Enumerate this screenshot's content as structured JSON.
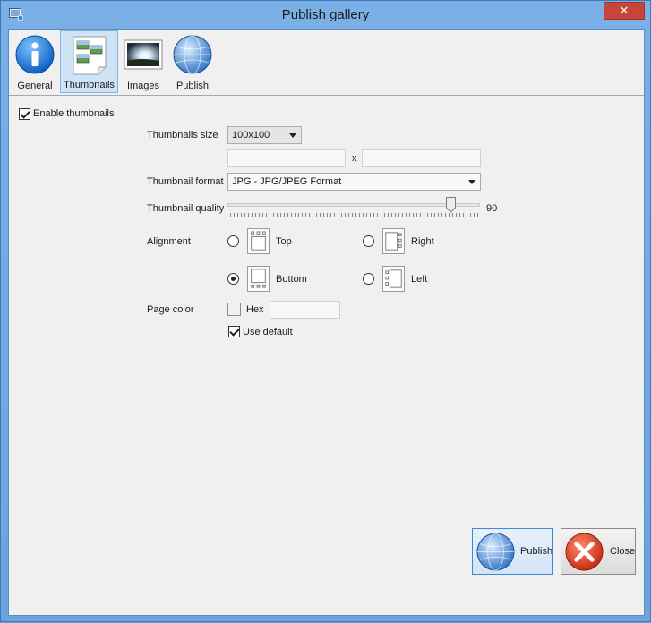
{
  "window": {
    "title": "Publish gallery",
    "close_symbol": "✕"
  },
  "toolbar": {
    "tabs": [
      {
        "label": "General",
        "icon": "info-icon"
      },
      {
        "label": "Thumbnails",
        "icon": "thumbnails-icon",
        "selected": true
      },
      {
        "label": "Images",
        "icon": "images-icon"
      },
      {
        "label": "Publish",
        "icon": "globe-icon"
      }
    ]
  },
  "form": {
    "enable_thumbnails": {
      "label": "Enable thumbnails",
      "checked": true
    },
    "thumbnails_size": {
      "label": "Thumbnails size",
      "value": "100x100"
    },
    "custom_size": {
      "separator": "x",
      "width": "",
      "height": ""
    },
    "thumbnail_format": {
      "label": "Thumbnail format",
      "value": "JPG - JPG/JPEG Format"
    },
    "thumbnail_quality": {
      "label": "Thumbnail quality",
      "value": "90",
      "level": 90,
      "min": 0,
      "max": 100
    },
    "alignment": {
      "label": "Alignment",
      "options": [
        {
          "label": "Top",
          "checked": false
        },
        {
          "label": "Right",
          "checked": false
        },
        {
          "label": "Bottom",
          "checked": true
        },
        {
          "label": "Left",
          "checked": false
        }
      ]
    },
    "page_color": {
      "label": "Page color",
      "hex_label": "Hex",
      "hex_value": ""
    },
    "use_default": {
      "label": "Use default",
      "checked": true
    }
  },
  "buttons": {
    "publish_label": "Publish",
    "close_label": "Close"
  },
  "colors": {
    "title_bar": "#6aa3de",
    "accent": "#3c8bd9",
    "close_red": "#c7463a"
  }
}
